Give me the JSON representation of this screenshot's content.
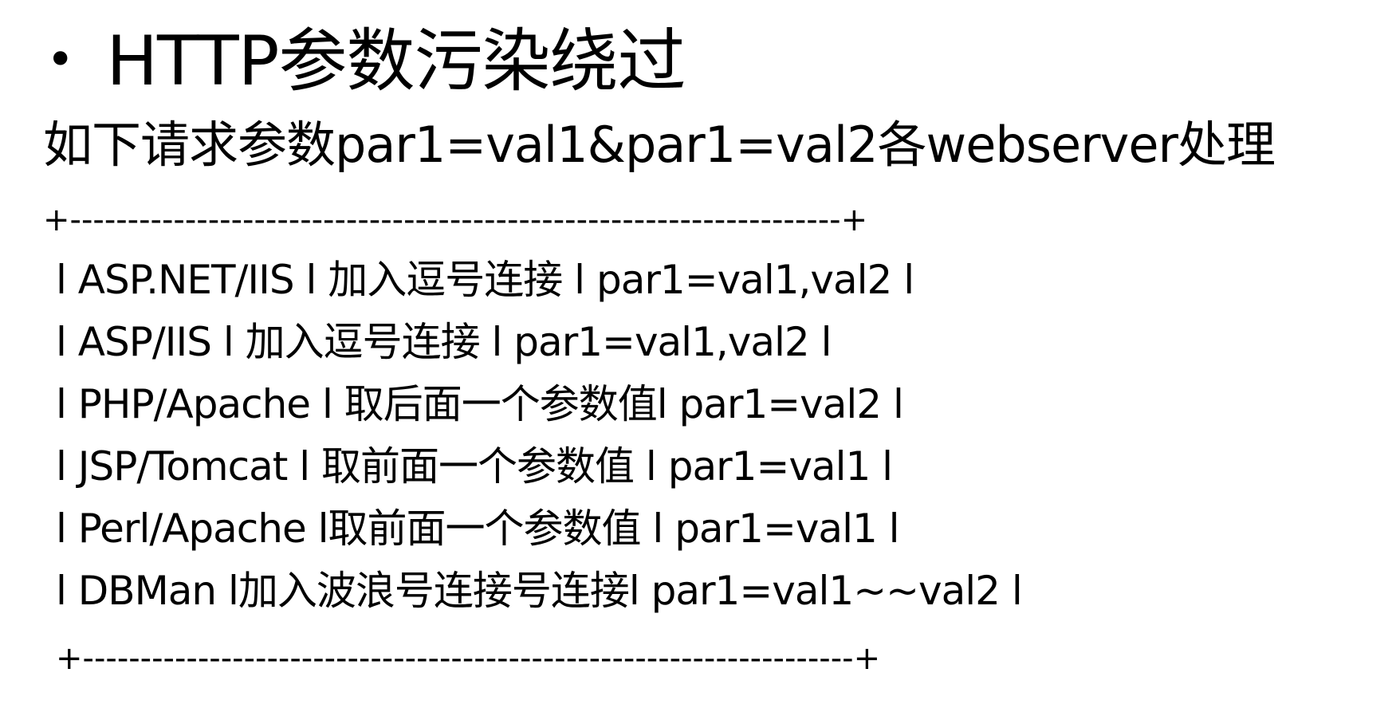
{
  "slide": {
    "bullet": "•",
    "title": "HTTP参数污染绕过",
    "subtitle": "如下请求参数par1=val1&par1=val2各webserver处理",
    "border_top": "+-------------------------------------------------------------------+",
    "rows": [
      "l ASP.NET/IIS l 加入逗号连接 l par1=val1,val2 l",
      "l ASP/IIS l 加入逗号连接 l par1=val1,val2 l",
      "l PHP/Apache l 取后面一个参数值l par1=val2 l",
      "l JSP/Tomcat l 取前面一个参数值 l par1=val1 l",
      "l Perl/Apache l取前面一个参数值 l par1=val1 l",
      "l DBMan l加入波浪号连接号连接l par1=val1~~val2 l"
    ],
    "border_bottom": "+-------------------------------------------------------------------+"
  }
}
